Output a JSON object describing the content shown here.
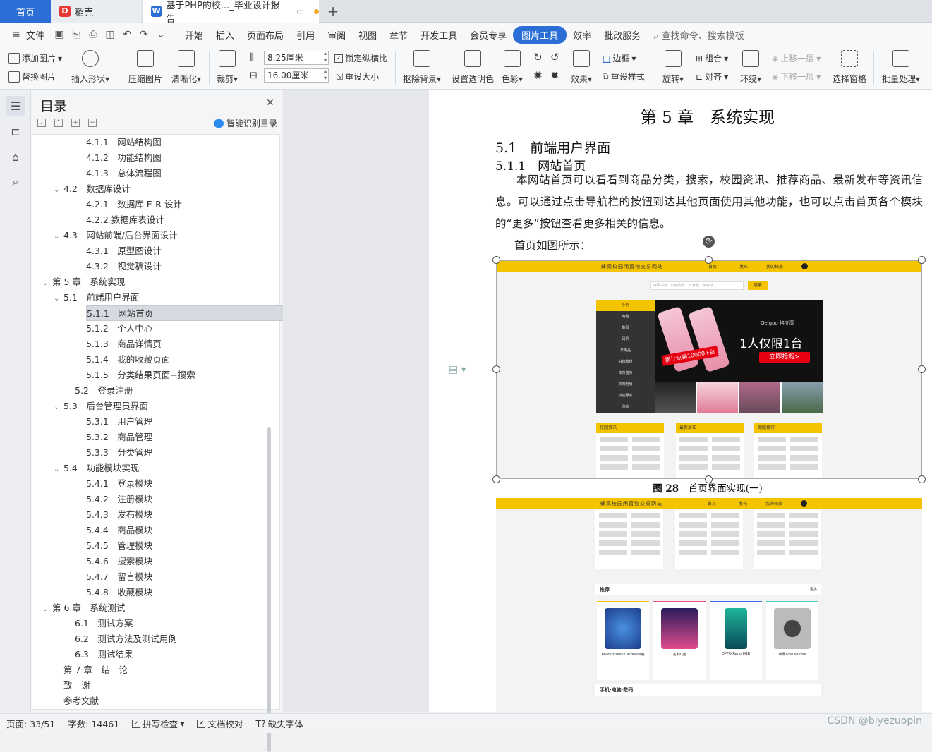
{
  "tabs": {
    "home": "首页",
    "docer": "稻壳",
    "doc": "基于PHP的校..._毕业设计报告"
  },
  "menu": {
    "file": "文件",
    "items": [
      "开始",
      "插入",
      "页面布局",
      "引用",
      "审阅",
      "视图",
      "章节",
      "开发工具",
      "会员专享"
    ],
    "active": "图片工具",
    "after": [
      "效率",
      "批改服务"
    ],
    "search": "查找命令、搜索模板"
  },
  "ribbon": {
    "add_image": "添加图片",
    "replace_image": "替换图片",
    "insert_shape": "插入形状",
    "compress": "压缩图片",
    "sharpen": "清晰化",
    "crop": "裁剪",
    "width": "8.25厘米",
    "height": "16.00厘米",
    "lock_ratio": "锁定纵横比",
    "reset_size": "重设大小",
    "remove_bg": "抠除背景",
    "set_transparent": "设置透明色",
    "color": "色彩",
    "effect": "效果",
    "border": "边框",
    "restyle": "重设样式",
    "rotate": "旋转",
    "group": "组合",
    "align": "对齐",
    "wrap": "环绕",
    "bring_forward": "上移一层",
    "send_backward": "下移一层",
    "select_pane": "选择窗格",
    "batch": "批量处理"
  },
  "toc": {
    "title": "目录",
    "smart": "智能识别目录",
    "items": [
      {
        "label": "4.1.1　网站结构图"
      },
      {
        "label": "4.1.2　功能结构图"
      },
      {
        "label": "4.1.3　总体流程图"
      },
      {
        "label": "4.2　数据库设计"
      },
      {
        "label": "4.2.1　数据库 E-R 设计"
      },
      {
        "label": "4.2.2 数据库表设计"
      },
      {
        "label": "4.3　网站前端/后台界面设计"
      },
      {
        "label": "4.3.1　原型图设计"
      },
      {
        "label": "4.3.2　视觉稿设计"
      },
      {
        "label": "第 5 章　系统实现"
      },
      {
        "label": "5.1　前端用户界面"
      },
      {
        "label": "5.1.1　网站首页"
      },
      {
        "label": "5.1.2　个人中心"
      },
      {
        "label": "5.1.3　商品详情页"
      },
      {
        "label": "5.1.4　我的收藏页面"
      },
      {
        "label": "5.1.5　分类结果页面+搜索"
      },
      {
        "label": "5.2　登录注册"
      },
      {
        "label": "5.3　后台管理员界面"
      },
      {
        "label": "5.3.1　用户管理"
      },
      {
        "label": "5.3.2　商品管理"
      },
      {
        "label": "5.3.3　分类管理"
      },
      {
        "label": "5.4　功能模块实现"
      },
      {
        "label": "5.4.1　登录模块"
      },
      {
        "label": "5.4.2　注册模块"
      },
      {
        "label": "5.4.3　发布模块"
      },
      {
        "label": "5.4.4　商品模块"
      },
      {
        "label": "5.4.5　管理模块"
      },
      {
        "label": "5.4.6　搜索模块"
      },
      {
        "label": "5.4.7　留言模块"
      },
      {
        "label": "5.4.8　收藏模块"
      },
      {
        "label": "第 6 章　系统测试"
      },
      {
        "label": "6.1　测试方案"
      },
      {
        "label": "6.2　测试方法及测试用例"
      },
      {
        "label": "6.3　测试结果"
      },
      {
        "label": "第 7 章　结　论"
      },
      {
        "label": "致　谢"
      },
      {
        "label": "参考文献"
      }
    ]
  },
  "doc": {
    "chapter": "第 5 章　系统实现",
    "h1": "5.1　前端用户界面",
    "h2": "5.1.1　网站首页",
    "para": "本网站首页可以看看到商品分类，搜索，校园资讯、推荐商品、最新发布等资讯信息。可以通过点击导航栏的按钮到达其他页面使用其他功能，也可以点击首页各个模块的“更多”按钮查看更多相关的信息。",
    "para2": "首页如图所示：",
    "caption_num": "图 28",
    "caption_text": "首页界面实现(一)",
    "site": {
      "title": "蜂窝校园闲置物交易网站",
      "nav": [
        "首页",
        "发布",
        "我的档案"
      ],
      "search_placeholder": "考研书籍、四级资料、计算机二级考试",
      "search_btn": "搜索",
      "cats": [
        "手机",
        "电脑",
        "数码",
        "耳机",
        "日用品",
        "书籍教材",
        "体育健身",
        "衣帽鞋服",
        "技能服务",
        "游戏"
      ],
      "banner_brand": "Gelgoo 格立高",
      "banner_text": "1人仅限1台",
      "banner_btn": "立即抢购>",
      "banner_badge": "累计热销10000+台",
      "cols": [
        "校园资讯",
        "最新发布",
        "跑腿排行"
      ],
      "rec": "推荐",
      "more": "更多",
      "cards": [
        "Beats studio2 wireless魔",
        "定制U盘",
        "OPPO Reno 8GB",
        "苹果iPod shuffle"
      ],
      "sec2": "手机·电脑·数码"
    }
  },
  "status": {
    "page": "页面: 33/51",
    "words": "字数: 14461",
    "spell": "拼写检查",
    "proof": "文档校对",
    "font": "缺失字体"
  },
  "watermark": "CSDN @biyezuopin"
}
